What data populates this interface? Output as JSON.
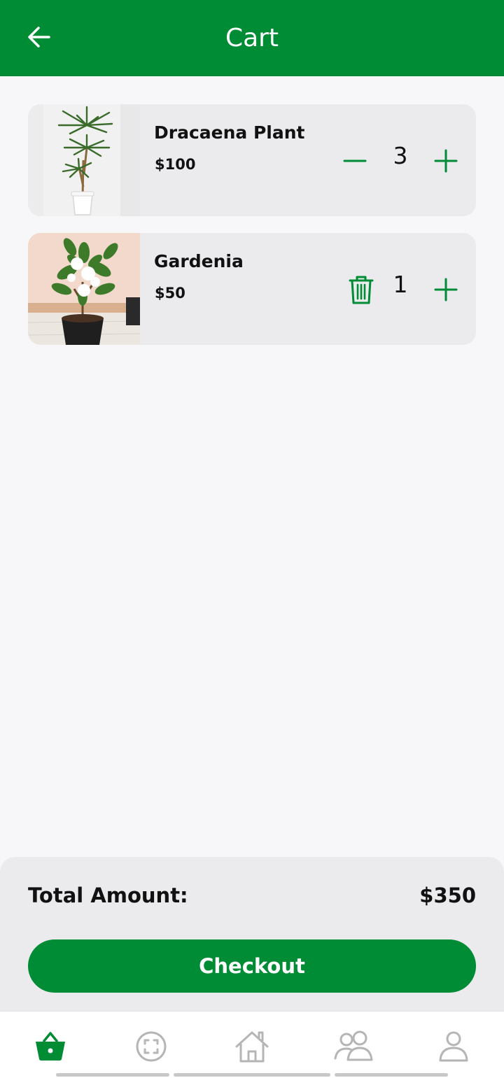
{
  "header": {
    "title": "Cart",
    "back_icon": "arrow-left-icon"
  },
  "cart": {
    "items": [
      {
        "name": "Dracaena Plant",
        "price": "$100",
        "quantity": "3",
        "left_control": "minus-icon",
        "right_control": "plus-icon",
        "image": "dracaena-plant-photo"
      },
      {
        "name": "Gardenia",
        "price": "$50",
        "quantity": "1",
        "left_control": "trash-icon",
        "right_control": "plus-icon",
        "image": "gardenia-plant-photo"
      }
    ]
  },
  "summary": {
    "total_label": "Total Amount:",
    "total_value": "$350",
    "checkout_label": "Checkout"
  },
  "bottom_nav": {
    "items": [
      {
        "icon": "basket-icon",
        "active": true
      },
      {
        "icon": "scan-icon",
        "active": false
      },
      {
        "icon": "home-icon",
        "active": false
      },
      {
        "icon": "community-icon",
        "active": false
      },
      {
        "icon": "profile-icon",
        "active": false
      }
    ]
  },
  "colors": {
    "brand_green": "#008c35",
    "background": "#f7f7f9",
    "card_background": "#ebebee",
    "inactive_icon": "#b5b5b5",
    "text": "#111111"
  }
}
